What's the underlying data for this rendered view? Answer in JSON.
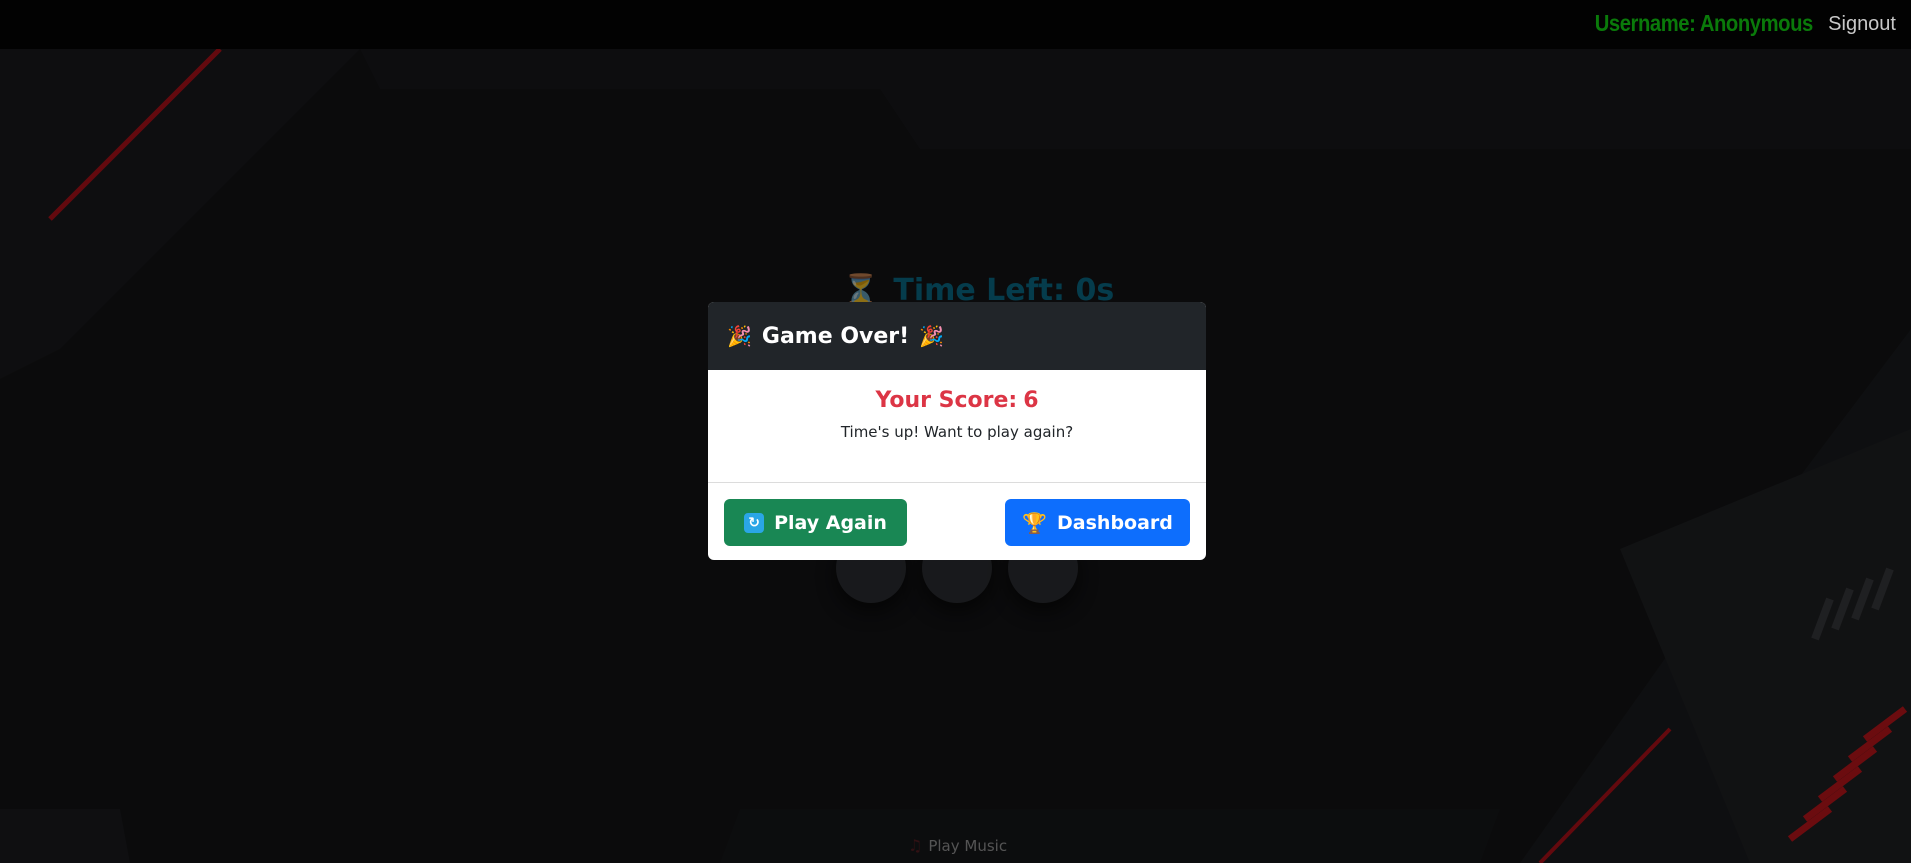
{
  "topbar": {
    "username": "Username: Anonymous",
    "signout": "Signout"
  },
  "game": {
    "timer_icon": "hourglass-icon",
    "timer_label": "Time Left: 0s",
    "music_label": "Play Music",
    "music_icon": "music-note-icon"
  },
  "modal": {
    "title": "Game Over!",
    "title_icon": "party-popper-icon",
    "score_label": "Your Score:",
    "score_value": "6",
    "message": "Time's up! Want to play again?",
    "play_again_label": "Play Again",
    "play_again_icon": "refresh-icon",
    "dashboard_label": "Dashboard",
    "dashboard_icon": "trophy-icon"
  },
  "colors": {
    "username": "#0a7a0a",
    "timer": "#0a6d8a",
    "score": "#dc3545",
    "play_again": "#198754",
    "dashboard": "#0d6efd",
    "modal_header": "#212529",
    "accent_stripe": "#c4161c"
  }
}
